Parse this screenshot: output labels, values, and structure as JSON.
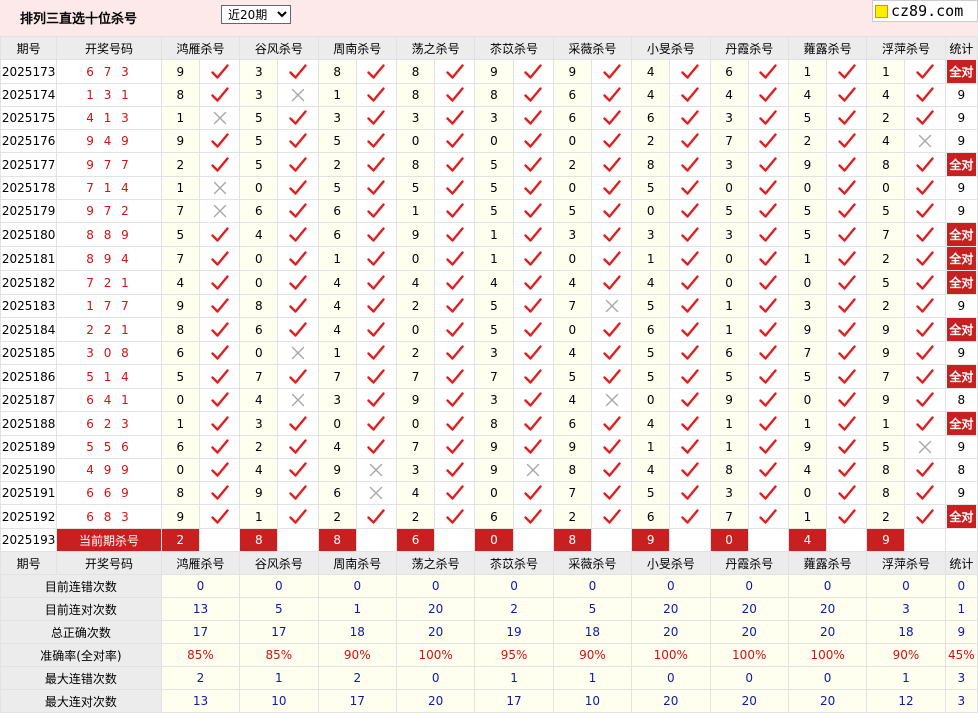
{
  "page": {
    "title": "排列三直选十位杀号",
    "period_select": {
      "selected": "近20期",
      "options": [
        "近20期"
      ]
    },
    "logo": {
      "text": "cz89.com",
      "icon": "yellow-square-icon"
    }
  },
  "colors": {
    "accent_red": "#c82020",
    "number_red": "#d61010",
    "summary_blue": "#0a1aa8",
    "header_gray": "#ececec"
  },
  "headers": [
    "期号",
    "开奖号码",
    "鸿雁杀号",
    "谷风杀号",
    "周南杀号",
    "荡之杀号",
    "苶苡杀号",
    "采薇杀号",
    "小旻杀号",
    "丹霞杀号",
    "蕹露杀号",
    "浮萍杀号",
    "统计"
  ],
  "rows": [
    {
      "period": "2025173",
      "draw": "673",
      "kills": [
        [
          "9",
          true
        ],
        [
          "3",
          true
        ],
        [
          "8",
          true
        ],
        [
          "8",
          true
        ],
        [
          "9",
          true
        ],
        [
          "9",
          true
        ],
        [
          "4",
          true
        ],
        [
          "6",
          true
        ],
        [
          "1",
          true
        ],
        [
          "1",
          true
        ]
      ],
      "stat": "全对"
    },
    {
      "period": "2025174",
      "draw": "131",
      "kills": [
        [
          "8",
          true
        ],
        [
          "3",
          false
        ],
        [
          "1",
          true
        ],
        [
          "8",
          true
        ],
        [
          "8",
          true
        ],
        [
          "6",
          true
        ],
        [
          "4",
          true
        ],
        [
          "4",
          true
        ],
        [
          "4",
          true
        ],
        [
          "4",
          true
        ]
      ],
      "stat": "9"
    },
    {
      "period": "2025175",
      "draw": "413",
      "kills": [
        [
          "1",
          false
        ],
        [
          "5",
          true
        ],
        [
          "3",
          true
        ],
        [
          "3",
          true
        ],
        [
          "3",
          true
        ],
        [
          "6",
          true
        ],
        [
          "6",
          true
        ],
        [
          "3",
          true
        ],
        [
          "5",
          true
        ],
        [
          "2",
          true
        ]
      ],
      "stat": "9"
    },
    {
      "period": "2025176",
      "draw": "949",
      "kills": [
        [
          "9",
          true
        ],
        [
          "5",
          true
        ],
        [
          "5",
          true
        ],
        [
          "0",
          true
        ],
        [
          "0",
          true
        ],
        [
          "0",
          true
        ],
        [
          "2",
          true
        ],
        [
          "7",
          true
        ],
        [
          "2",
          true
        ],
        [
          "4",
          false
        ]
      ],
      "stat": "9"
    },
    {
      "period": "2025177",
      "draw": "977",
      "kills": [
        [
          "2",
          true
        ],
        [
          "5",
          true
        ],
        [
          "2",
          true
        ],
        [
          "8",
          true
        ],
        [
          "5",
          true
        ],
        [
          "2",
          true
        ],
        [
          "8",
          true
        ],
        [
          "3",
          true
        ],
        [
          "9",
          true
        ],
        [
          "8",
          true
        ]
      ],
      "stat": "全对"
    },
    {
      "period": "2025178",
      "draw": "714",
      "kills": [
        [
          "1",
          false
        ],
        [
          "0",
          true
        ],
        [
          "5",
          true
        ],
        [
          "5",
          true
        ],
        [
          "5",
          true
        ],
        [
          "0",
          true
        ],
        [
          "5",
          true
        ],
        [
          "0",
          true
        ],
        [
          "0",
          true
        ],
        [
          "0",
          true
        ]
      ],
      "stat": "9"
    },
    {
      "period": "2025179",
      "draw": "972",
      "kills": [
        [
          "7",
          false
        ],
        [
          "6",
          true
        ],
        [
          "6",
          true
        ],
        [
          "1",
          true
        ],
        [
          "5",
          true
        ],
        [
          "5",
          true
        ],
        [
          "0",
          true
        ],
        [
          "5",
          true
        ],
        [
          "5",
          true
        ],
        [
          "5",
          true
        ]
      ],
      "stat": "9"
    },
    {
      "period": "2025180",
      "draw": "889",
      "kills": [
        [
          "5",
          true
        ],
        [
          "4",
          true
        ],
        [
          "6",
          true
        ],
        [
          "9",
          true
        ],
        [
          "1",
          true
        ],
        [
          "3",
          true
        ],
        [
          "3",
          true
        ],
        [
          "3",
          true
        ],
        [
          "5",
          true
        ],
        [
          "7",
          true
        ]
      ],
      "stat": "全对"
    },
    {
      "period": "2025181",
      "draw": "894",
      "kills": [
        [
          "7",
          true
        ],
        [
          "0",
          true
        ],
        [
          "1",
          true
        ],
        [
          "0",
          true
        ],
        [
          "1",
          true
        ],
        [
          "0",
          true
        ],
        [
          "1",
          true
        ],
        [
          "0",
          true
        ],
        [
          "1",
          true
        ],
        [
          "2",
          true
        ]
      ],
      "stat": "全对"
    },
    {
      "period": "2025182",
      "draw": "721",
      "kills": [
        [
          "4",
          true
        ],
        [
          "0",
          true
        ],
        [
          "4",
          true
        ],
        [
          "4",
          true
        ],
        [
          "4",
          true
        ],
        [
          "4",
          true
        ],
        [
          "4",
          true
        ],
        [
          "0",
          true
        ],
        [
          "0",
          true
        ],
        [
          "5",
          true
        ]
      ],
      "stat": "全对"
    },
    {
      "period": "2025183",
      "draw": "177",
      "kills": [
        [
          "9",
          true
        ],
        [
          "8",
          true
        ],
        [
          "4",
          true
        ],
        [
          "2",
          true
        ],
        [
          "5",
          true
        ],
        [
          "7",
          false
        ],
        [
          "5",
          true
        ],
        [
          "1",
          true
        ],
        [
          "3",
          true
        ],
        [
          "2",
          true
        ]
      ],
      "stat": "9"
    },
    {
      "period": "2025184",
      "draw": "221",
      "kills": [
        [
          "8",
          true
        ],
        [
          "6",
          true
        ],
        [
          "4",
          true
        ],
        [
          "0",
          true
        ],
        [
          "5",
          true
        ],
        [
          "0",
          true
        ],
        [
          "6",
          true
        ],
        [
          "1",
          true
        ],
        [
          "9",
          true
        ],
        [
          "9",
          true
        ]
      ],
      "stat": "全对"
    },
    {
      "period": "2025185",
      "draw": "308",
      "kills": [
        [
          "6",
          true
        ],
        [
          "0",
          false
        ],
        [
          "1",
          true
        ],
        [
          "2",
          true
        ],
        [
          "3",
          true
        ],
        [
          "4",
          true
        ],
        [
          "5",
          true
        ],
        [
          "6",
          true
        ],
        [
          "7",
          true
        ],
        [
          "9",
          true
        ]
      ],
      "stat": "9"
    },
    {
      "period": "2025186",
      "draw": "514",
      "kills": [
        [
          "5",
          true
        ],
        [
          "7",
          true
        ],
        [
          "7",
          true
        ],
        [
          "7",
          true
        ],
        [
          "7",
          true
        ],
        [
          "5",
          true
        ],
        [
          "5",
          true
        ],
        [
          "5",
          true
        ],
        [
          "5",
          true
        ],
        [
          "7",
          true
        ]
      ],
      "stat": "全对"
    },
    {
      "period": "2025187",
      "draw": "641",
      "kills": [
        [
          "0",
          true
        ],
        [
          "4",
          false
        ],
        [
          "3",
          true
        ],
        [
          "9",
          true
        ],
        [
          "3",
          true
        ],
        [
          "4",
          false
        ],
        [
          "0",
          true
        ],
        [
          "9",
          true
        ],
        [
          "0",
          true
        ],
        [
          "9",
          true
        ]
      ],
      "stat": "8"
    },
    {
      "period": "2025188",
      "draw": "623",
      "kills": [
        [
          "1",
          true
        ],
        [
          "3",
          true
        ],
        [
          "0",
          true
        ],
        [
          "0",
          true
        ],
        [
          "8",
          true
        ],
        [
          "6",
          true
        ],
        [
          "4",
          true
        ],
        [
          "1",
          true
        ],
        [
          "1",
          true
        ],
        [
          "1",
          true
        ]
      ],
      "stat": "全对"
    },
    {
      "period": "2025189",
      "draw": "556",
      "kills": [
        [
          "6",
          true
        ],
        [
          "2",
          true
        ],
        [
          "4",
          true
        ],
        [
          "7",
          true
        ],
        [
          "9",
          true
        ],
        [
          "9",
          true
        ],
        [
          "1",
          true
        ],
        [
          "1",
          true
        ],
        [
          "9",
          true
        ],
        [
          "5",
          false
        ]
      ],
      "stat": "9"
    },
    {
      "period": "2025190",
      "draw": "499",
      "kills": [
        [
          "0",
          true
        ],
        [
          "4",
          true
        ],
        [
          "9",
          false
        ],
        [
          "3",
          true
        ],
        [
          "9",
          false
        ],
        [
          "8",
          true
        ],
        [
          "4",
          true
        ],
        [
          "8",
          true
        ],
        [
          "4",
          true
        ],
        [
          "8",
          true
        ]
      ],
      "stat": "8"
    },
    {
      "period": "2025191",
      "draw": "669",
      "kills": [
        [
          "8",
          true
        ],
        [
          "9",
          true
        ],
        [
          "6",
          false
        ],
        [
          "4",
          true
        ],
        [
          "0",
          true
        ],
        [
          "7",
          true
        ],
        [
          "5",
          true
        ],
        [
          "3",
          true
        ],
        [
          "0",
          true
        ],
        [
          "8",
          true
        ]
      ],
      "stat": "9"
    },
    {
      "period": "2025192",
      "draw": "683",
      "kills": [
        [
          "9",
          true
        ],
        [
          "1",
          true
        ],
        [
          "2",
          true
        ],
        [
          "2",
          true
        ],
        [
          "6",
          true
        ],
        [
          "2",
          true
        ],
        [
          "6",
          true
        ],
        [
          "7",
          true
        ],
        [
          "1",
          true
        ],
        [
          "2",
          true
        ]
      ],
      "stat": "全对"
    }
  ],
  "current": {
    "period": "2025193",
    "label": "当前期杀号",
    "values": [
      "2",
      "8",
      "8",
      "6",
      "0",
      "8",
      "9",
      "0",
      "4",
      "9"
    ]
  },
  "summary": [
    {
      "label": "目前连错次数",
      "values": [
        "0",
        "0",
        "0",
        "0",
        "0",
        "0",
        "0",
        "0",
        "0",
        "0",
        "0"
      ],
      "red": false
    },
    {
      "label": "目前连对次数",
      "values": [
        "13",
        "5",
        "1",
        "20",
        "2",
        "5",
        "20",
        "20",
        "20",
        "3",
        "1"
      ],
      "red": false
    },
    {
      "label": "总正确次数",
      "values": [
        "17",
        "17",
        "18",
        "20",
        "19",
        "18",
        "20",
        "20",
        "20",
        "18",
        "9"
      ],
      "red": false
    },
    {
      "label": "准确率(全对率)",
      "values": [
        "85%",
        "85%",
        "90%",
        "100%",
        "95%",
        "90%",
        "100%",
        "100%",
        "100%",
        "90%",
        "45%"
      ],
      "red": true
    },
    {
      "label": "最大连错次数",
      "values": [
        "2",
        "1",
        "2",
        "0",
        "1",
        "1",
        "0",
        "0",
        "0",
        "1",
        "3"
      ],
      "red": false
    },
    {
      "label": "最大连对次数",
      "values": [
        "13",
        "10",
        "17",
        "20",
        "17",
        "10",
        "20",
        "20",
        "20",
        "12",
        "3"
      ],
      "red": false
    }
  ]
}
